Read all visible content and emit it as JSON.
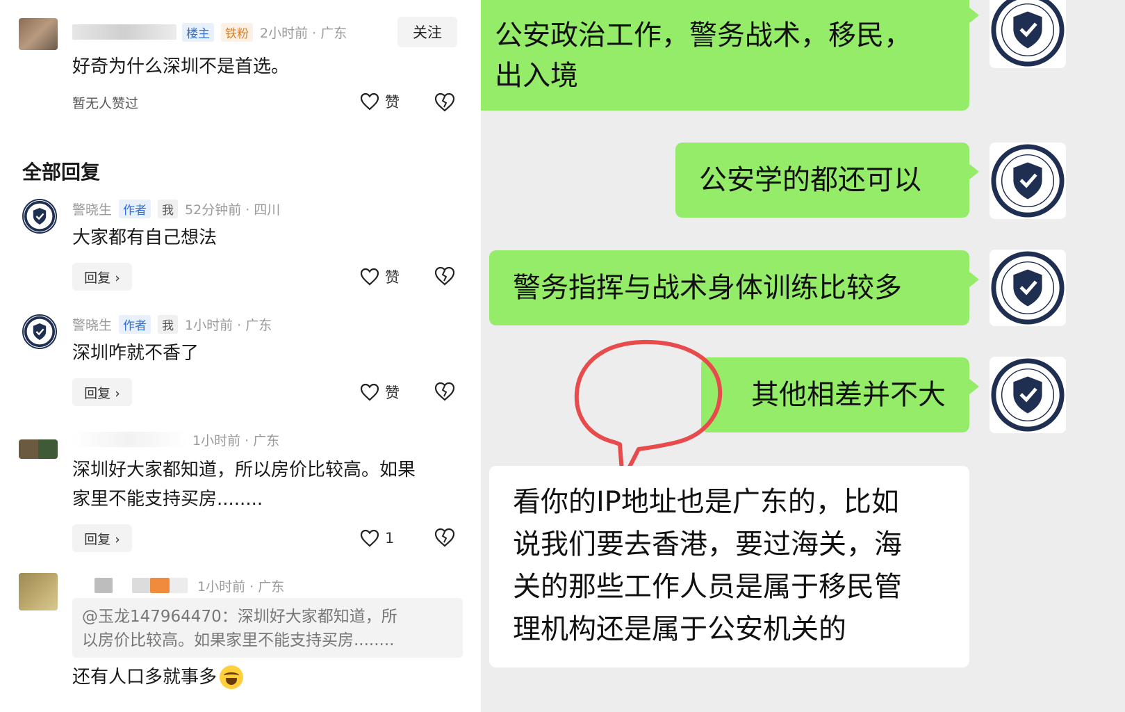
{
  "left": {
    "top_comment": {
      "meta_tags": [
        "楼主",
        "铁粉"
      ],
      "time": "2小时前 · 广东",
      "follow_label": "关注",
      "text": "好奇为什么深圳不是首选。",
      "no_like_text": "暂无人赞过",
      "like_label": "赞"
    },
    "all_replies_title": "全部回复",
    "replies": [
      {
        "name": "警晓生",
        "tags": [
          "作者",
          "我"
        ],
        "time": "52分钟前 · 四川",
        "text": "大家都有自己想法",
        "reply_label": "回复 ›",
        "like_label": "赞"
      },
      {
        "name": "警晓生",
        "tags": [
          "作者",
          "我"
        ],
        "time": "1小时前 · 广东",
        "text": "深圳咋就不香了",
        "reply_label": "回复 ›",
        "like_label": "赞"
      },
      {
        "time": "1小时前 · 广东",
        "text_line1": "深圳好大家都知道，所以房价比较高。如果",
        "text_line2": "家里不能支持买房........",
        "reply_label": "回复 ›",
        "like_label": "1"
      },
      {
        "time": "1小时前 · 广东",
        "quote_line1": "@玉龙147964470：深圳好大家都知道，所",
        "quote_line2": "以房价比较高。如果家里不能支持买房........",
        "text": "还有人口多就事多"
      }
    ]
  },
  "chat": {
    "messages": [
      {
        "side": "right",
        "line1": "公安政治工作，警务战术，移民，",
        "line2": "出入境"
      },
      {
        "side": "right",
        "line1": "公安学的都还可以"
      },
      {
        "side": "right",
        "line1": "警务指挥与战术身体训练比较多"
      },
      {
        "side": "right",
        "line1": "其他相差并不大"
      },
      {
        "side": "left",
        "line1": "看你的IP地址也是广东的，比如",
        "line2": "说我们要去香港，要过海关，海",
        "line3": "关的那些工作人员是属于移民管",
        "line4": "理机构还是属于公安机关的"
      }
    ]
  },
  "colors": {
    "chat_green": "#95ec69",
    "chat_bg": "#ededed",
    "annotation_red": "#e84b4b",
    "badge_navy": "#1f2f52"
  },
  "icons": [
    "heart-outline-icon",
    "broken-heart-icon",
    "police-badge-avatar-icon",
    "laughing-crying-emoji-icon"
  ]
}
